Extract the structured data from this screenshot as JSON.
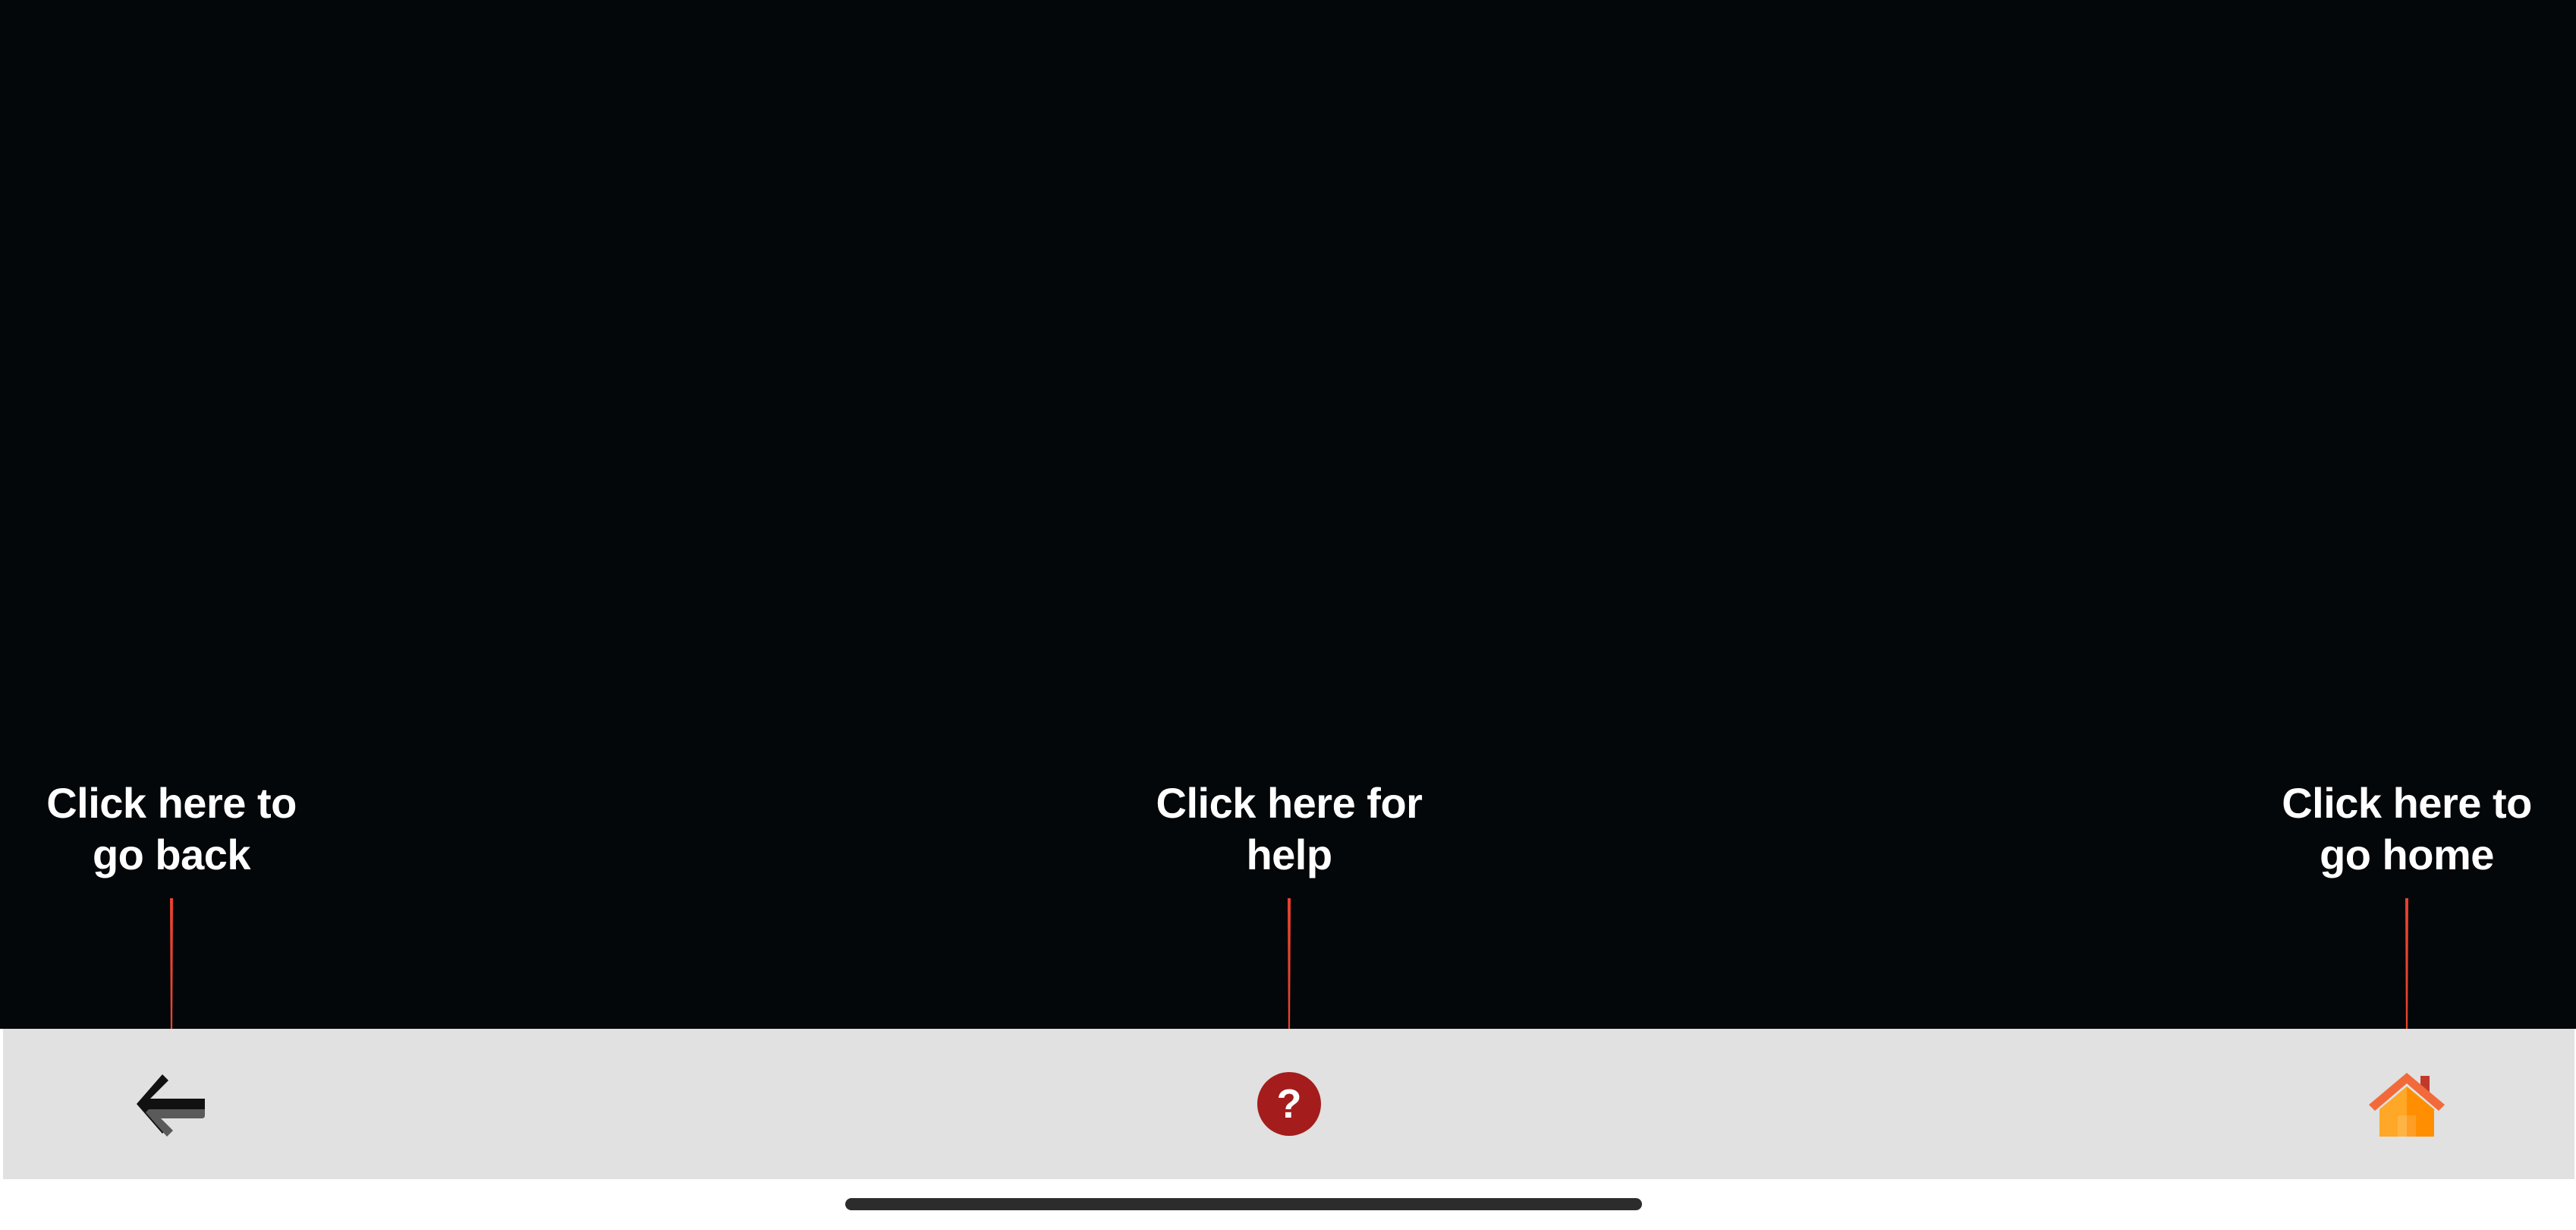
{
  "hints": {
    "back": {
      "line1": "Click here to",
      "line2": "go back"
    },
    "help": {
      "line1": "Click here for",
      "line2": "help"
    },
    "home": {
      "line1": "Click here to",
      "line2": "go home"
    }
  },
  "toolbar": {
    "back_icon": "back-arrow-icon",
    "help_icon": "question-mark-icon",
    "home_icon": "house-icon",
    "help_glyph": "?"
  },
  "colors": {
    "content_background": "#030709",
    "toolbar_background": "#e0e1e0",
    "pointer": "#e8432f",
    "help_badge": "#a51c1c",
    "home_roof": "#f26a3a",
    "home_body": "#ffa726"
  }
}
